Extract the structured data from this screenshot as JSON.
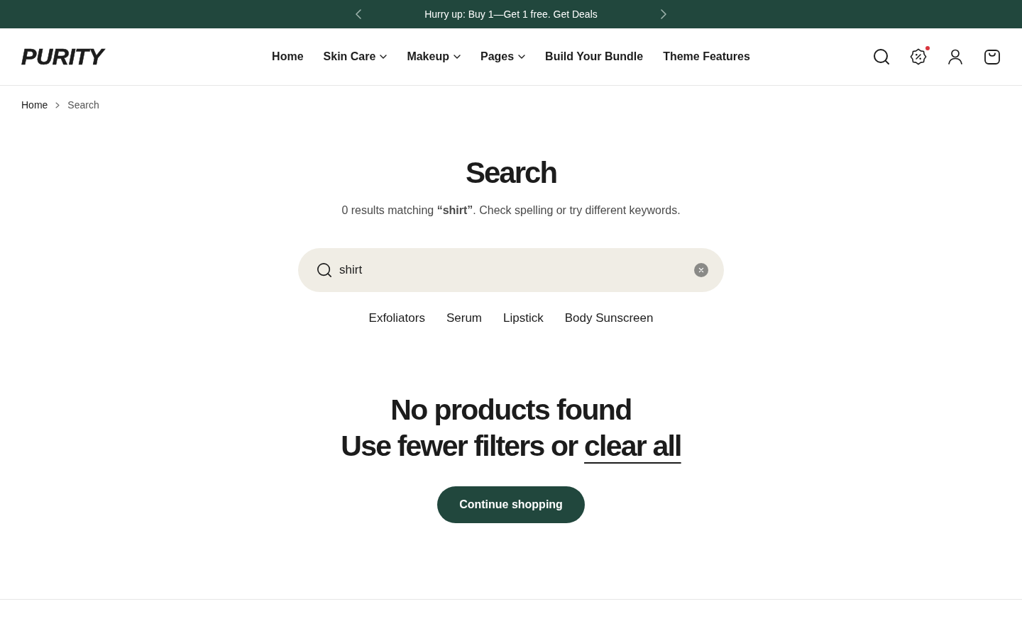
{
  "announcement": {
    "text": "Hurry up: Buy 1—Get 1 free. Get Deals"
  },
  "header": {
    "logo": "PURITY",
    "nav": [
      {
        "label": "Home",
        "dropdown": false
      },
      {
        "label": "Skin Care",
        "dropdown": true
      },
      {
        "label": "Makeup",
        "dropdown": true
      },
      {
        "label": "Pages",
        "dropdown": true
      },
      {
        "label": "Build Your Bundle",
        "dropdown": false
      },
      {
        "label": "Theme Features",
        "dropdown": false
      }
    ],
    "deals_notification": true
  },
  "breadcrumb": [
    {
      "label": "Home",
      "current": false
    },
    {
      "label": "Search",
      "current": true
    }
  ],
  "search": {
    "title": "Search",
    "summary": "0 results matching **“shirt”**. Check spelling or try different keywords.",
    "value": "shirt",
    "suggestions": [
      "Exfoliators",
      "Serum",
      "Lipstick",
      "Body Sunscreen"
    ]
  },
  "empty_state": {
    "title": "No products found",
    "hint": "Use fewer filters or",
    "link": "clear all",
    "button": "Continue shopping"
  }
}
